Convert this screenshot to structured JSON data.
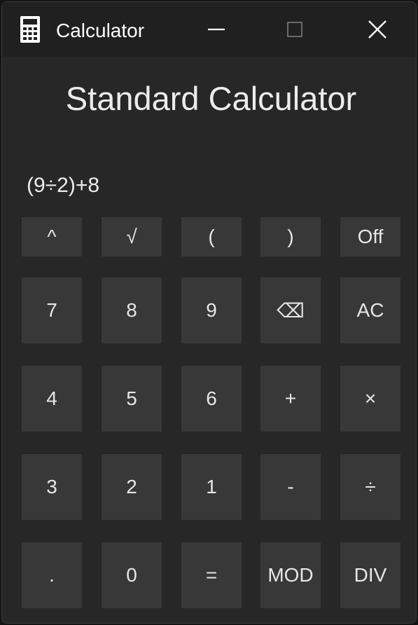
{
  "window": {
    "title": "Calculator",
    "icon": "calculator-icon",
    "controls": [
      "minimize-icon",
      "maximize-icon",
      "close-icon"
    ]
  },
  "heading": "Standard Calculator",
  "display": {
    "expression": "(9÷2)+8"
  },
  "keys": {
    "row0": [
      "^",
      "√",
      "(",
      ")",
      "Off"
    ],
    "row1": [
      "7",
      "8",
      "9",
      "⌫",
      "AC"
    ],
    "row2": [
      "4",
      "5",
      "6",
      "+",
      "×"
    ],
    "row3": [
      "3",
      "2",
      "1",
      "-",
      "÷"
    ],
    "row4": [
      ".",
      "0",
      "=",
      "MOD",
      "DIV"
    ]
  },
  "colors": {
    "window_bg": "#272727",
    "titlebar_bg": "#202020",
    "button_bg": "#383838",
    "text": "#ececec"
  }
}
